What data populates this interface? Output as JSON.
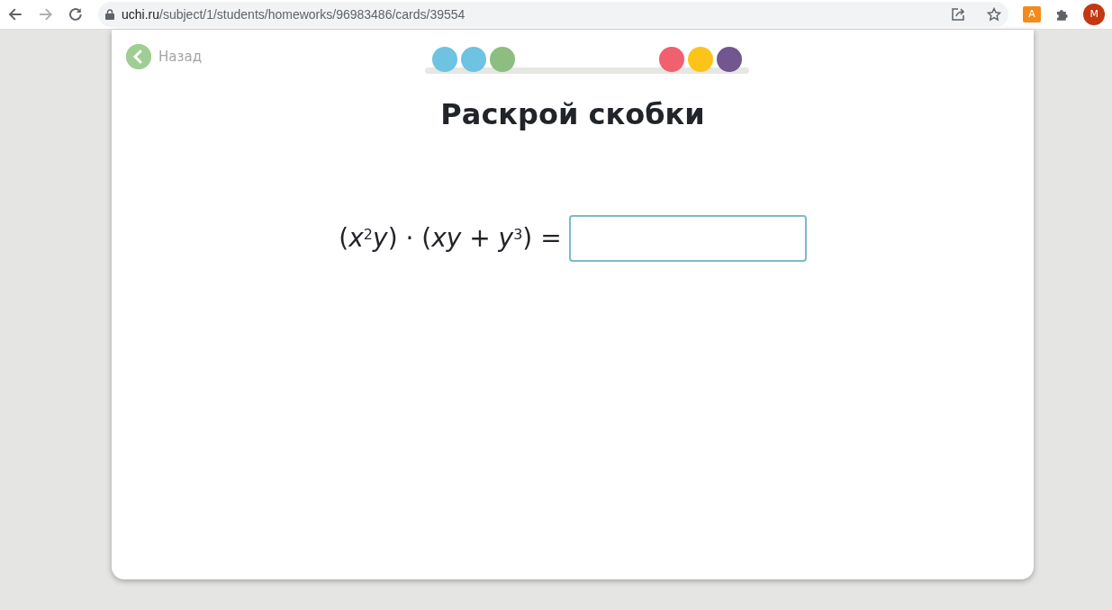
{
  "browser": {
    "url_host": "uchi.ru",
    "url_path": "/subject/1/students/homeworks/96983486/cards/39554",
    "extension_label": "A",
    "profile_initial": "M"
  },
  "back_link": {
    "label": "Назад"
  },
  "progress": [
    {
      "color": "#6ec2e2"
    },
    {
      "color": "#6ec2e2"
    },
    {
      "color": "#8dbd80"
    },
    {
      "color": "#f0606e"
    },
    {
      "color": "#fcc419"
    },
    {
      "color": "#71568f"
    }
  ],
  "title": "Раскрой скобки",
  "task": {
    "expression": "(*x*$^{2}$*y*) · (*xy* + *y*$^{3}$) ="
  }
}
